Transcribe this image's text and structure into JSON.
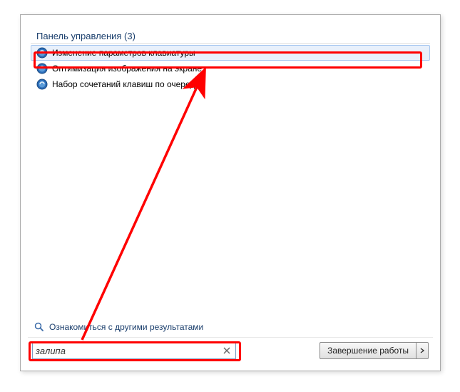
{
  "category": {
    "label": "Панель управления (3)"
  },
  "results": [
    {
      "label": "Изменение параметров клавиатуры"
    },
    {
      "label": "Оптимизация изображения на экране"
    },
    {
      "label": "Набор сочетаний клавиш по очереди"
    }
  ],
  "more_results_label": "Ознакомиться с другими результатами",
  "search": {
    "value": "залипа"
  },
  "shutdown": {
    "label": "Завершение работы"
  },
  "annotation": {
    "highlight_color": "#ff0000"
  }
}
